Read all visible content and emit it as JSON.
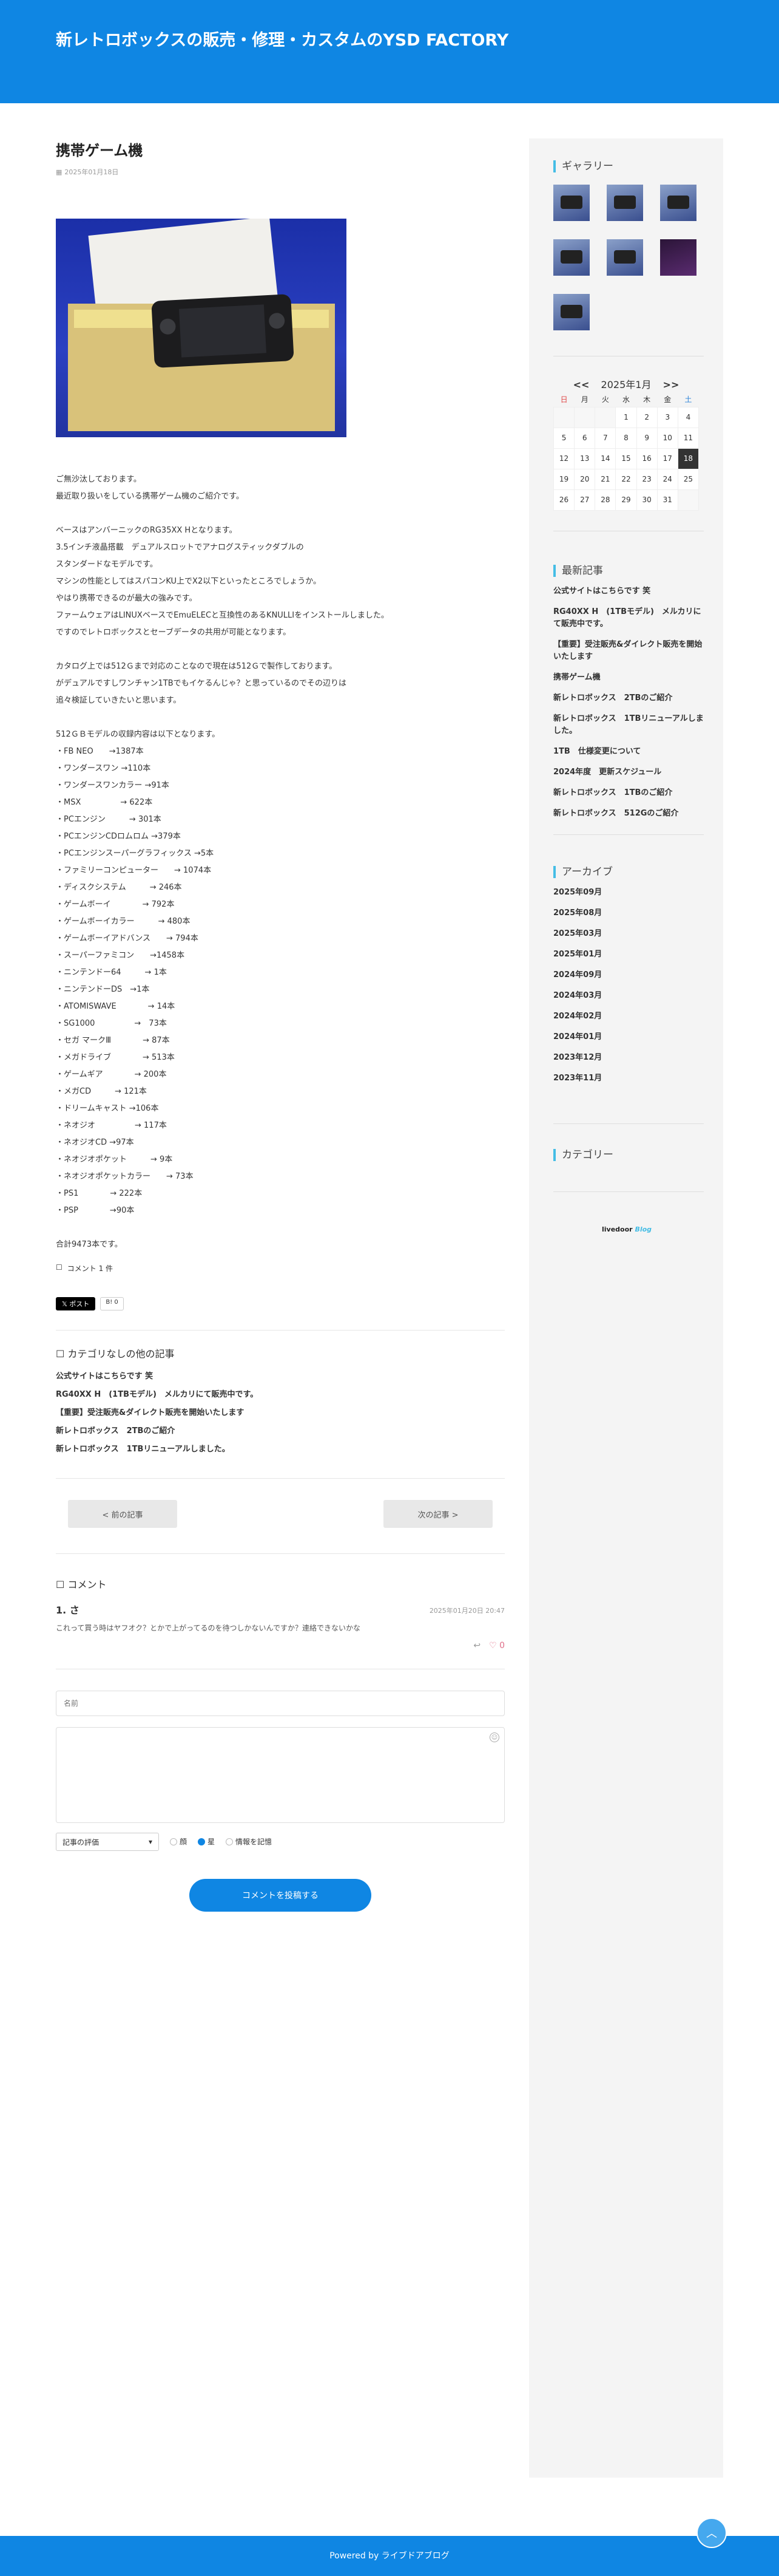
{
  "site": {
    "title": "新レトロボックスの販売・修理・カスタムのYSD FACTORY"
  },
  "post": {
    "title": "携帯ゲーム機",
    "date": "2025年01月18日",
    "paragraphs": [
      "ご無沙汰しております。\n最近取り扱いをしている携帯ゲーム機のご紹介です。",
      "ベースはアンバーニックのRG35XX Hとなります。\n3.5インチ液晶搭載　デュアルスロットでアナログスティックダブルの\nスタンダードなモデルです。\nマシンの性能としてはスパコンKU上でX2以下といったところでしょうか。\nやはり携帯できるのが最大の強みです。\nファームウェアはLINUXベースでEmuELECと互換性のあるKNULLIをインストールしました。\nですのでレトロボックスとセーブデータの共用が可能となります。",
      "カタログ上では512Ｇまで対応のことなので現在は512Ｇで製作しております。\nがデュアルですしワンチャン1TBでもイケるんじゃ？と思っているのでその辺りは\n追々検証していきたいと思います。"
    ],
    "list_intro": "512ＧＢモデルの収録内容は以下となります。",
    "list": [
      "・FB NEO　　→1387本",
      "・ワンダースワン →110本",
      "・ワンダースワンカラー →91本",
      "・MSX　　　　　→ 622本",
      "・PCエンジン　　　→ 301本",
      "・PCエンジンCDロムロム →379本",
      "・PCエンジンスーパーグラフィックス →5本",
      "・ファミリーコンピューター　　→ 1074本",
      "・ディスクシステム　　　→ 246本",
      "・ゲームボーイ　　　　→ 792本",
      "・ゲームボーイカラー　　　→ 480本",
      "・ゲームボーイアドバンス　　→ 794本",
      "・スーパーファミコン　　→1458本",
      "・ニンテンドー64　　　→ 1本",
      "・ニンテンドーDS　→1本",
      "・ATOMISWAVE　　　　→ 14本",
      "・SG1000　　　　　→　73本",
      "・セガ マークⅢ　　　　→ 87本",
      "・メガドライブ　　　　→ 513本",
      "・ゲームギア　　　　→ 200本",
      "・メガCD　　　→ 121本",
      "・ドリームキャスト →106本",
      "・ネオジオ　　　　　→ 117本",
      "・ネオジオCD →97本",
      "・ネオジオポケット　　　→ 9本",
      "・ネオジオポケットカラー　　→ 73本",
      "・PS1　　　　→ 222本",
      "・PSP　　　　→90本"
    ],
    "total": "合計9473本です。",
    "comment_count": "コメント 1 件"
  },
  "share": {
    "post_label": "ポスト",
    "bookmark_label": "0"
  },
  "related": {
    "heading": "カテゴリなしの他の記事",
    "items": [
      "公式サイトはこちらです 笑",
      "RG40XX H　(1TBモデル)　メルカリにて販売中です。",
      "【重要】受注販売&ダイレクト販売を開始いたします",
      "新レトロボックス　2TBのご紹介",
      "新レトロボックス　1TBリニューアルしました。"
    ]
  },
  "nav": {
    "prev": "< 前の記事",
    "next": "次の記事 >"
  },
  "comments": {
    "heading": "コメント",
    "items": [
      {
        "name": "1. さ",
        "date": "2025年01月20日 20:47",
        "body": "これって買う時はヤフオク？とかで上がってるのを待つしかないんですか？連絡できないかな",
        "likes": "0"
      }
    ]
  },
  "form": {
    "name_placeholder": "名前",
    "rating_label": "記事の評価",
    "radio_1": "顔",
    "radio_2": "星",
    "remember": "情報を記憶",
    "submit": "コメントを投稿する"
  },
  "sidebar": {
    "gallery_title": "ギャラリー",
    "calendar": {
      "prev": "<<",
      "title": "2025年1月",
      "next": ">>",
      "weekdays": [
        "日",
        "月",
        "火",
        "水",
        "木",
        "金",
        "土"
      ],
      "weeks": [
        [
          "",
          "",
          "",
          "1",
          "2",
          "3",
          "4"
        ],
        [
          "5",
          "6",
          "7",
          "8",
          "9",
          "10",
          "11"
        ],
        [
          "12",
          "13",
          "14",
          "15",
          "16",
          "17",
          "18"
        ],
        [
          "19",
          "20",
          "21",
          "22",
          "23",
          "24",
          "25"
        ],
        [
          "26",
          "27",
          "28",
          "29",
          "30",
          "31",
          ""
        ]
      ],
      "today": "18"
    },
    "recent_title": "最新記事",
    "recent": [
      "公式サイトはこちらです 笑",
      "RG40XX H　(1TBモデル)　メルカリにて販売中です。",
      "【重要】受注販売&ダイレクト販売を開始いたします",
      "携帯ゲーム機",
      "新レトロボックス　2TBのご紹介",
      "新レトロボックス　1TBリニューアルしました。",
      "1TB　仕様変更について",
      "2024年度　更新スケジュール",
      "新レトロボックス　1TBのご紹介",
      "新レトロボックス　512Gのご紹介"
    ],
    "archive_title": "アーカイブ",
    "archive": [
      "2025年09月",
      "2025年08月",
      "2025年03月",
      "2025年01月",
      "2024年09月",
      "2024年03月",
      "2024年02月",
      "2024年01月",
      "2023年12月",
      "2023年11月"
    ],
    "category_title": "カテゴリー",
    "livedoor_a": "livedoor",
    "livedoor_b": "Blog"
  },
  "footer": {
    "text": "Powered by ライブドアブログ"
  },
  "colors": {
    "brand": "#0f86e3",
    "accent": "#45bde5"
  }
}
